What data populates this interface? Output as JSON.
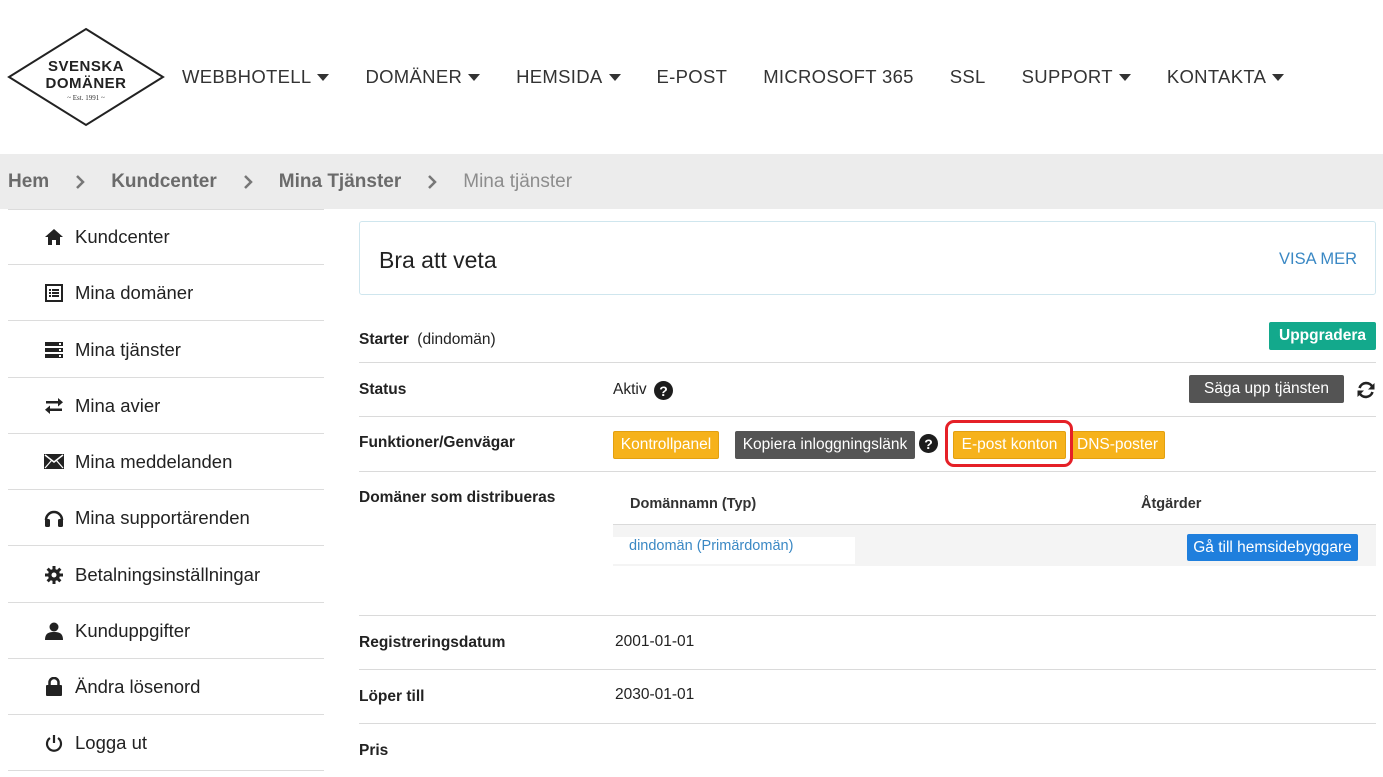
{
  "logo": {
    "line1": "SVENSKA",
    "line2": "DOMÄNER",
    "line3": "~ Est. 1991 ~"
  },
  "nav": [
    {
      "label": "WEBBHOTELL",
      "caret": true
    },
    {
      "label": "DOMÄNER",
      "caret": true
    },
    {
      "label": "HEMSIDA",
      "caret": true
    },
    {
      "label": "E-POST",
      "caret": false
    },
    {
      "label": "MICROSOFT 365",
      "caret": false
    },
    {
      "label": "SSL",
      "caret": false
    },
    {
      "label": "SUPPORT",
      "caret": true
    },
    {
      "label": "KONTAKTA",
      "caret": true
    }
  ],
  "breadcrumb": {
    "items": [
      "Hem",
      "Kundcenter",
      "Mina Tjänster"
    ],
    "current": "Mina tjänster"
  },
  "sidebar": {
    "items": [
      {
        "label": "Kundcenter",
        "icon": "home-icon"
      },
      {
        "label": "Mina domäner",
        "icon": "list-icon"
      },
      {
        "label": "Mina tjänster",
        "icon": "server-icon"
      },
      {
        "label": "Mina avier",
        "icon": "transfer-icon"
      },
      {
        "label": "Mina meddelanden",
        "icon": "envelope-icon"
      },
      {
        "label": "Mina supportärenden",
        "icon": "headphones-icon"
      },
      {
        "label": "Betalningsinställningar",
        "icon": "gear-icon"
      },
      {
        "label": "Kunduppgifter",
        "icon": "user-icon"
      },
      {
        "label": "Ändra lösenord",
        "icon": "lock-icon"
      },
      {
        "label": "Logga ut",
        "icon": "power-icon"
      }
    ]
  },
  "infobox": {
    "title": "Bra att veta",
    "more": "VISA MER"
  },
  "service": {
    "name": "Starter",
    "domain": "(dindomän)",
    "upgrade_label": "Uppgradera"
  },
  "status": {
    "label": "Status",
    "value": "Aktiv",
    "cancel_label": "Säga upp tjänsten"
  },
  "shortcuts": {
    "label": "Funktioner/Genvägar",
    "control_panel": "Kontrollpanel",
    "copy_login": "Kopiera inloggningslänk",
    "email_accounts": "E-post konton",
    "dns": "DNS-poster"
  },
  "domains": {
    "label": "Domäner som distribueras",
    "col_name": "Domännamn (Typ)",
    "col_actions": "Åtgärder",
    "rows": [
      {
        "name": "dindomän (Primärdomän)",
        "action": "Gå till hemsidebyggare"
      }
    ]
  },
  "registered": {
    "label": "Registreringsdatum",
    "value": "2001-01-01"
  },
  "expires": {
    "label": "Löper till",
    "value": "2030-01-01"
  },
  "price": {
    "label": "Pris"
  },
  "colors": {
    "accent_teal": "#13a98c",
    "button_yellow": "#f6b21b",
    "button_blue": "#1f7fdd",
    "button_dark": "#545454",
    "link_blue": "#3a88c4",
    "highlight_red": "#e52027"
  }
}
